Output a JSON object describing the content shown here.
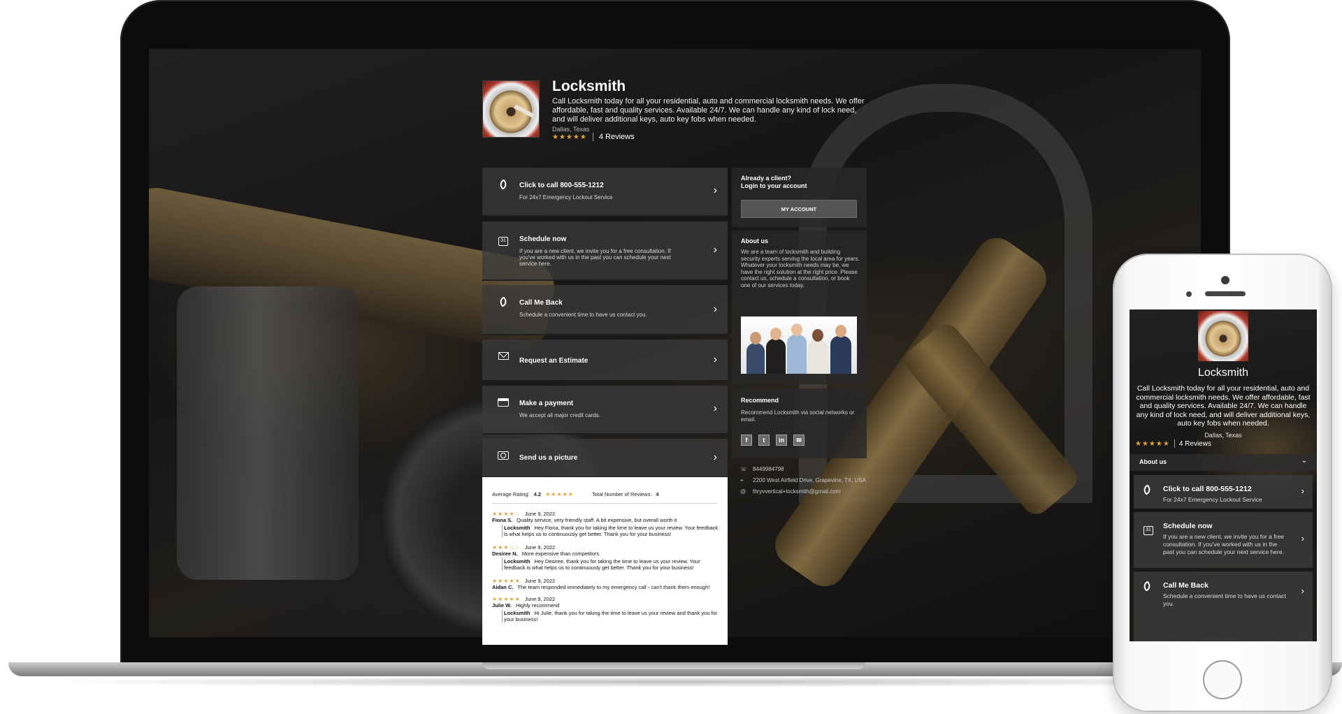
{
  "desktop": {
    "header": {
      "title": "Locksmith",
      "description": "Call Locksmith today for all your residential, auto and commercial locksmith needs. We offer affordable, fast and quality services. Available 24/7. We can handle any kind of lock need, and will deliver additional keys, auto key fobs when needed.",
      "location": "Dallas, Texas",
      "stars": "★★★★★",
      "reviews_label": "4 Reviews"
    },
    "actions": [
      {
        "icon": "phone-icon",
        "title": "Click to call 800-555-1212",
        "subtitle": "For 24x7 Emergency Lockout Service"
      },
      {
        "icon": "calendar-icon",
        "title": "Schedule now",
        "subtitle": "If you are a new client, we invite you for a free consultation. If you've worked with us in the past you can schedule your next service here."
      },
      {
        "icon": "callback-icon",
        "title": "Call Me Back",
        "subtitle": "Schedule a convenient time to have us contact you."
      },
      {
        "icon": "envelope-icon",
        "title": "Request an Estimate",
        "subtitle": ""
      },
      {
        "icon": "credit-card-icon",
        "title": "Make a payment",
        "subtitle": "We accept all major credit cards."
      },
      {
        "icon": "camera-icon",
        "title": "Send us a picture",
        "subtitle": ""
      }
    ],
    "chevron": "›",
    "review_summary": {
      "avg_label": "Average Rating:",
      "avg_value": "4.2",
      "avg_stars": "★★★★★",
      "total_label": "Total Number of Reviews:",
      "total_value": "4"
    },
    "reviews": [
      {
        "stars": "★★★★☆",
        "date": "June 9, 2022",
        "author": "Fiona S.",
        "text": "Quality service, very friendly staff. A bit expensive, but overall worth it",
        "responder": "Locksmith",
        "response": "Hey Fiona, thank you for taking the time to leave us your review. Your feedback is what helps us to continuously get better. Thank you for your business!"
      },
      {
        "stars": "★★★☆☆",
        "date": "June 9, 2022",
        "author": "Desiree N.",
        "text": "More expensive than competitors",
        "responder": "Locksmith",
        "response": "Hey Desiree, thank you for taking the time to leave us your review. Your feedback is what helps us to continuously get better. Thank you for your business!"
      },
      {
        "stars": "★★★★★",
        "date": "June 9, 2022",
        "author": "Aidan C.",
        "text": "The team responded immediately to my emergency call - can't thank them enough!",
        "responder": "",
        "response": ""
      },
      {
        "stars": "★★★★★",
        "date": "June 9, 2022",
        "author": "Julie W.",
        "text": "Highly recommend",
        "responder": "Locksmith",
        "response": "Hi Julie, thank you for taking the time to leave us your review and thank you for your business!"
      }
    ],
    "account": {
      "line1": "Already a client?",
      "line2": "Login to your account",
      "button": "MY ACCOUNT"
    },
    "about": {
      "title": "About us",
      "text": "We are a team of locksmith and building security experts serving the local area for years. Whatever your locksmith needs may be, we have the right solution at the right price. Please contact us, schedule a consultation, or book one of our services today."
    },
    "recommend": {
      "title": "Recommend",
      "text": "Recommend Locksmith via social networks or email.",
      "icons": [
        "f",
        "t",
        "in",
        "✉"
      ]
    },
    "contact": {
      "phone": "8449984798",
      "address": "2200 West Airfield Drive, Grapevine, TX, USA",
      "email": "thryvvertical+locksmith@gmail.com"
    }
  },
  "mobile": {
    "title": "Locksmith",
    "description": "Call Locksmith today for all your residential, auto and commercial locksmith needs. We offer affordable, fast and quality services. Available 24/7. We can handle any kind of lock need, and will deliver additional keys, auto key fobs when needed.",
    "location": "Dallas, Texas",
    "stars": "★★★★★",
    "reviews_label": "4 Reviews",
    "about_label": "About us",
    "dropdown": "⌄",
    "actions": [
      {
        "title": "Click to call 800-555-1212",
        "subtitle": "For 24x7 Emergency Lockout Service"
      },
      {
        "title": "Schedule now",
        "subtitle": "If you are a new client, we invite you for a free consultation. If you've worked with us in the past you can schedule your next service here."
      },
      {
        "title": "Call Me Back",
        "subtitle": "Schedule a convenient time to have us contact you."
      }
    ]
  },
  "colors": {
    "star": "#e0a23b",
    "card_bg": "#3a3a3a",
    "panel_bg": "#282828"
  }
}
